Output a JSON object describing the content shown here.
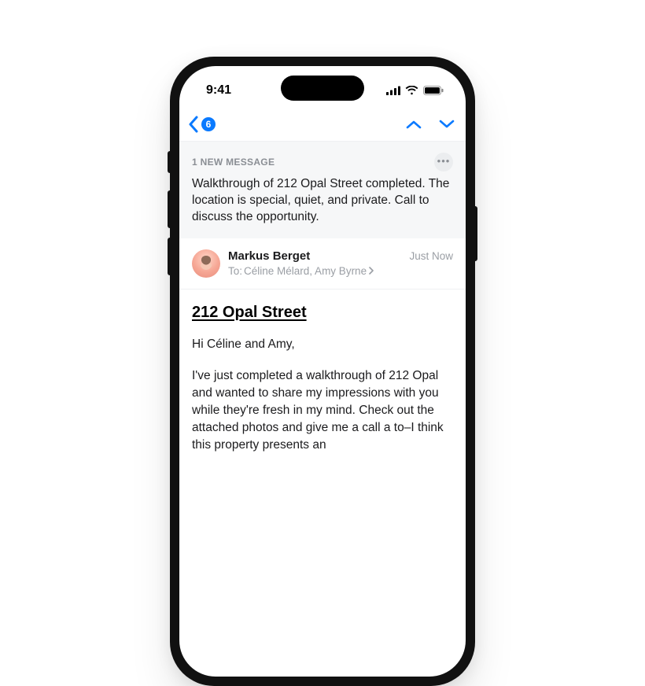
{
  "status": {
    "time": "9:41"
  },
  "nav": {
    "unread_count": "6"
  },
  "summary": {
    "label": "1 NEW MESSAGE",
    "text": "Walkthrough of 212 Opal Street completed. The location is special, quiet, and private. Call to discuss the opportunity."
  },
  "sender": {
    "name": "Markus Berget",
    "to_label": "To:",
    "recipients": "Céline Mélard, Amy Byrne",
    "timestamp": "Just Now"
  },
  "email": {
    "title": "212 Opal Street ",
    "greeting": "Hi Céline and Amy,",
    "para1": "I've just completed a walkthrough of 212 Opal and wanted to share my impressions with you while they're fresh in my mind. Check out the attached photos and give me a call a to–I think this property presents an"
  },
  "colors": {
    "accent": "#0a7aff"
  }
}
